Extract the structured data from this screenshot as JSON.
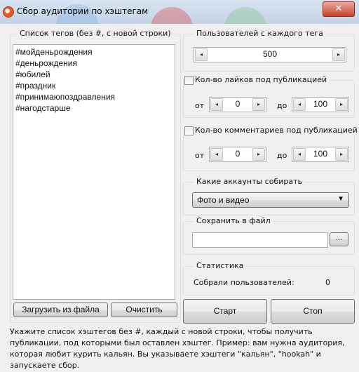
{
  "window": {
    "title": "Сбор аудитории по хэштегам",
    "close_glyph": "✕"
  },
  "tags_panel": {
    "legend": "Список тегов (без #, с новой строки)",
    "tags": [
      "#мойденьрождения",
      "#деньрождения",
      "#юбилей",
      "#праздник",
      "#принимаюпоздравления",
      "#нагодстарше"
    ],
    "load_button": "Загрузить из файла",
    "clear_button": "Очистить"
  },
  "users_per_tag": {
    "legend": "Пользователей с каждого тега",
    "value": "500"
  },
  "likes_filter": {
    "label": "Кол-во лайков под публикацией",
    "checked": false,
    "from_label": "от",
    "from_value": "0",
    "to_label": "до",
    "to_value": "100"
  },
  "comments_filter": {
    "label": "Кол-во комментариев под публикацией",
    "checked": false,
    "from_label": "от",
    "from_value": "0",
    "to_label": "до",
    "to_value": "100"
  },
  "accounts": {
    "legend": "Какие аккаунты собирать",
    "selected": "Фото и видео"
  },
  "save_file": {
    "legend": "Сохранить в файл",
    "value": "",
    "browse_label": "..."
  },
  "stats": {
    "legend": "Статистика",
    "collected_label": "Собрали пользователей:",
    "collected_value": "0"
  },
  "actions": {
    "start": "Старт",
    "stop": "Стоп"
  },
  "help_text": "Укажите список хэштегов без #, каждый с новой строки, чтобы получить публикации, под которыми был оставлен хэштег. Пример: вам нужна аудитория, которая любит курить кальян. Вы указываете хэштеги \"кальян\", \"hookah\" и запускаете сбор."
}
